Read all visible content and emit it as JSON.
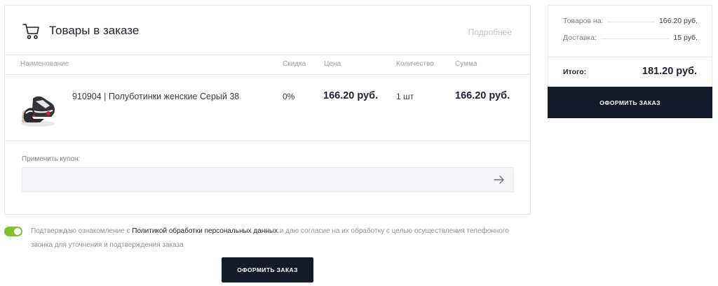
{
  "order": {
    "title": "Товары в заказе",
    "details_link": "Подробнее",
    "columns": {
      "name": "Наименование",
      "discount": "Скидка",
      "price": "Цена",
      "quantity": "Количество",
      "sum": "Сумма"
    },
    "items": [
      {
        "name": "910904 | Полуботинки женские Серый 38",
        "discount": "0%",
        "price": "166.20 руб.",
        "quantity": "1 шт",
        "sum": "166.20 руб."
      }
    ],
    "coupon": {
      "label": "Применить купон:",
      "value": "",
      "placeholder": ""
    }
  },
  "consent": {
    "checked": true,
    "text_before": "Подтверждаю ознакомление с ",
    "link": "Политикой обработки персональных данных",
    "text_after": " и даю согласие на их обработку с целью осуществления телефонного звонка для уточнения и подтверждения заказа"
  },
  "summary": {
    "goods_label": "Товаров на:",
    "goods_value": "166.20 руб.",
    "delivery_label": "Доставка:",
    "delivery_value": "15 руб.",
    "total_label": "Итого:",
    "total_value": "181.20 руб.",
    "checkout_button": "ОФОРМИТЬ ЗАКАЗ"
  },
  "checkout_bottom_button": "ОФОРМИТЬ ЗАКАЗ",
  "colors": {
    "dark_button": "#151a2a",
    "toggle_on": "#7ec32d",
    "border": "#e6e6e9",
    "muted_text": "#9b9ea8"
  },
  "icons": {
    "cart": "shopping-cart-icon",
    "coupon_submit": "arrow-right-icon",
    "product": "product-thumbnail"
  }
}
